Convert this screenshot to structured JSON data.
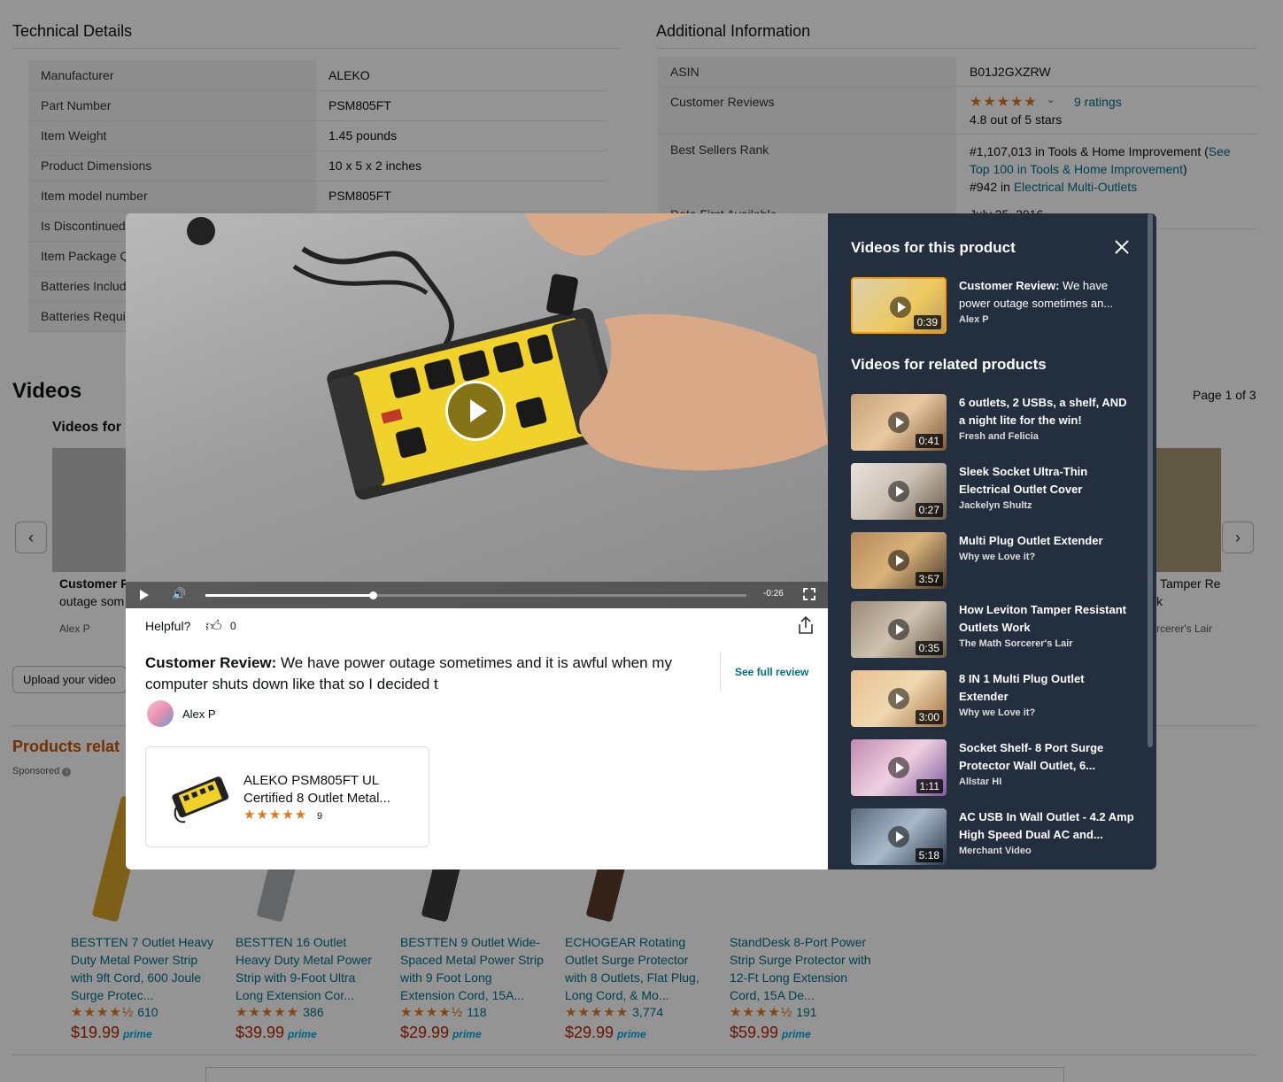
{
  "technical_details": {
    "title": "Technical Details",
    "rows": [
      {
        "k": "Manufacturer",
        "v": "ALEKO"
      },
      {
        "k": "Part Number",
        "v": "PSM805FT"
      },
      {
        "k": "Item Weight",
        "v": "1.45 pounds"
      },
      {
        "k": "Product Dimensions",
        "v": "10 x 5 x 2 inches"
      },
      {
        "k": "Item model number",
        "v": "PSM805FT"
      },
      {
        "k": "Is Discontinued",
        "v": ""
      },
      {
        "k": "Item Package Q",
        "v": ""
      },
      {
        "k": "Batteries Includ",
        "v": ""
      },
      {
        "k": "Batteries Requi",
        "v": ""
      }
    ]
  },
  "additional_info": {
    "title": "Additional Information",
    "asin_label": "ASIN",
    "asin_value": "B01J2GXZRW",
    "reviews_label": "Customer Reviews",
    "stars": "★★★★★",
    "ratings_link": "9 ratings",
    "rating_text": "4.8 out of 5 stars",
    "bsr_label": "Best Sellers Rank",
    "bsr_line1": "#1,107,013 in Tools & Home Improvement (",
    "bsr_link1": "See Top 100 in Tools & Home Improvement",
    "bsr_line1_end": ")",
    "bsr_line2": "#942 in ",
    "bsr_link2": "Electrical Multi-Outlets",
    "date_label": "Date First Available",
    "date_value": "July 25, 2016"
  },
  "videos_section": {
    "title": "Videos",
    "subtitle": "Videos for",
    "page_info": "Page 1 of 3",
    "card_left_title": "Customer R",
    "card_left_sub": "outage som",
    "card_left_author": "Alex P",
    "card_right_title": "Tamper Re",
    "card_right_sub": "k",
    "card_right_author": "rcerer's Lair",
    "upload_button": "Upload your video"
  },
  "related_products": {
    "title": "Products relat",
    "sponsored": "Sponsored",
    "items": [
      {
        "title": "BESTTEN 7 Outlet Heavy Duty Metal Power Strip with 9ft Cord, 600 Joule Surge Protec...",
        "stars": "★★★★½",
        "count": "610",
        "price": "$19.99"
      },
      {
        "title": "BESTTEN 16 Outlet Heavy Duty Metal Power Strip with 9-Foot Ultra Long Extension Cor...",
        "stars": "★★★★★",
        "count": "386",
        "price": "$39.99"
      },
      {
        "title": "BESTTEN 9 Outlet Wide-Spaced Metal Power Strip with 9 Foot Long Extension Cord, 15A...",
        "stars": "★★★★½",
        "count": "118",
        "price": "$29.99"
      },
      {
        "title": "ECHOGEAR Rotating Outlet Surge Protector with 8 Outlets, Flat Plug, Long Cord, & Mo...",
        "stars": "★★★★★",
        "count": "3,774",
        "price": "$29.99"
      },
      {
        "title": "StandDesk 8-Port Power Strip Surge Protector with 12-Ft Long Extension Cord, 15A De...",
        "stars": "★★★★½",
        "count": "191",
        "price": "$59.99"
      }
    ],
    "prime": "prime"
  },
  "modal": {
    "time_remaining": "-0:26",
    "progress": 0.31,
    "helpful_label": "Helpful?",
    "helpful_count": "0",
    "review_prefix": "Customer Review:",
    "review_text": " We have power outage sometimes and it is awful when my computer shuts down like that so I decided t",
    "see_full_review": "See full review",
    "author": "Alex P",
    "product_title": "ALEKO PSM805FT UL Certified 8 Outlet Metal...",
    "product_stars": "★★★★★",
    "product_rating_count": "9",
    "side_heading_this": "Videos for this product",
    "side_heading_related": "Videos for related products",
    "this_video": {
      "prefix": "Customer Review:",
      "title": " We have power outage sometimes an...",
      "by": "Alex P",
      "dur": "0:39"
    },
    "related_videos": [
      {
        "title": "6 outlets, 2 USBs, a shelf, AND a night lite for the win!",
        "by": "Fresh and Felicia",
        "dur": "0:41"
      },
      {
        "title": "Sleek Socket Ultra-Thin Electrical Outlet Cover",
        "by": "Jackelyn Shultz",
        "dur": "0:27"
      },
      {
        "title": "Multi Plug Outlet Extender",
        "by": "Why we Love it?",
        "dur": "3:57"
      },
      {
        "title": "How Leviton Tamper Resistant Outlets Work",
        "by": "The Math Sorcerer's Lair",
        "dur": "0:35"
      },
      {
        "title": "8 IN 1 Multi Plug Outlet Extender",
        "by": "Why we Love it?",
        "dur": "3:00"
      },
      {
        "title": "Socket Shelf- 8 Port Surge Protector Wall Outlet, 6...",
        "by": "Allstar HI",
        "dur": "1:11"
      },
      {
        "title": "AC USB In Wall Outlet - 4.2 Amp High Speed Dual AC and...",
        "by": "Merchant Video",
        "dur": "5:18"
      }
    ]
  },
  "colors": {
    "accent": "#ff9900",
    "sidebar": "#232f3e",
    "link": "#007185",
    "price": "#b12704"
  }
}
